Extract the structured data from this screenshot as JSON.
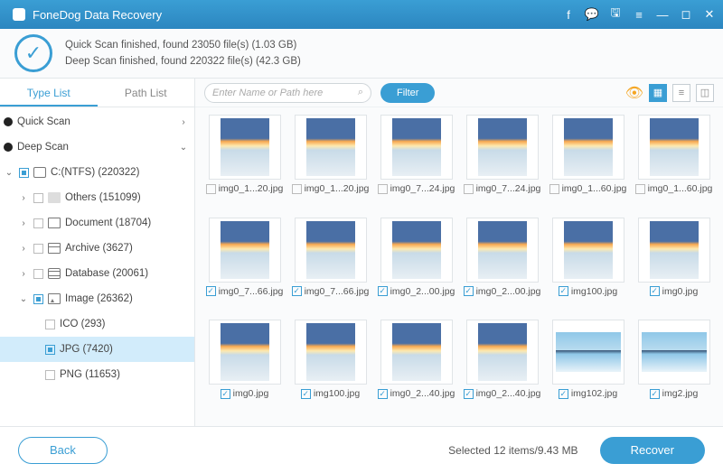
{
  "app": {
    "title": "FoneDog Data Recovery"
  },
  "scan": {
    "quick": "Quick Scan finished, found 23050 file(s) (1.03 GB)",
    "deep": "Deep Scan finished, found 220322 file(s) (42.3 GB)"
  },
  "tabs": {
    "type": "Type List",
    "path": "Path List"
  },
  "tree": {
    "quick": "Quick Scan",
    "deep": "Deep Scan",
    "disk": "C:(NTFS) (220322)",
    "others": "Others (151099)",
    "document": "Document (18704)",
    "archive": "Archive (3627)",
    "database": "Database (20061)",
    "image": "Image (26362)",
    "ico": "ICO (293)",
    "jpg": "JPG (7420)",
    "png": "PNG (11653)"
  },
  "toolbar": {
    "search_placeholder": "Enter Name or Path here",
    "filter": "Filter"
  },
  "thumbs": [
    {
      "name": "img0_1...20.jpg",
      "checked": false,
      "variant": "sky"
    },
    {
      "name": "img0_1...20.jpg",
      "checked": false,
      "variant": "sky"
    },
    {
      "name": "img0_7...24.jpg",
      "checked": false,
      "variant": "sky"
    },
    {
      "name": "img0_7...24.jpg",
      "checked": false,
      "variant": "sky"
    },
    {
      "name": "img0_1...60.jpg",
      "checked": false,
      "variant": "sky"
    },
    {
      "name": "img0_1...60.jpg",
      "checked": false,
      "variant": "sky"
    },
    {
      "name": "img0_7...66.jpg",
      "checked": true,
      "variant": "sky"
    },
    {
      "name": "img0_7...66.jpg",
      "checked": true,
      "variant": "sky"
    },
    {
      "name": "img0_2...00.jpg",
      "checked": true,
      "variant": "sky"
    },
    {
      "name": "img0_2...00.jpg",
      "checked": true,
      "variant": "sky"
    },
    {
      "name": "img100.jpg",
      "checked": true,
      "variant": "sky"
    },
    {
      "name": "img0.jpg",
      "checked": true,
      "variant": "sky"
    },
    {
      "name": "img0.jpg",
      "checked": true,
      "variant": "sky"
    },
    {
      "name": "img100.jpg",
      "checked": true,
      "variant": "sky"
    },
    {
      "name": "img0_2...40.jpg",
      "checked": true,
      "variant": "sky"
    },
    {
      "name": "img0_2...40.jpg",
      "checked": true,
      "variant": "sky"
    },
    {
      "name": "img102.jpg",
      "checked": true,
      "variant": "reflect"
    },
    {
      "name": "img2.jpg",
      "checked": true,
      "variant": "reflect"
    }
  ],
  "footer": {
    "back": "Back",
    "status": "Selected 12 items/9.43 MB",
    "recover": "Recover"
  }
}
